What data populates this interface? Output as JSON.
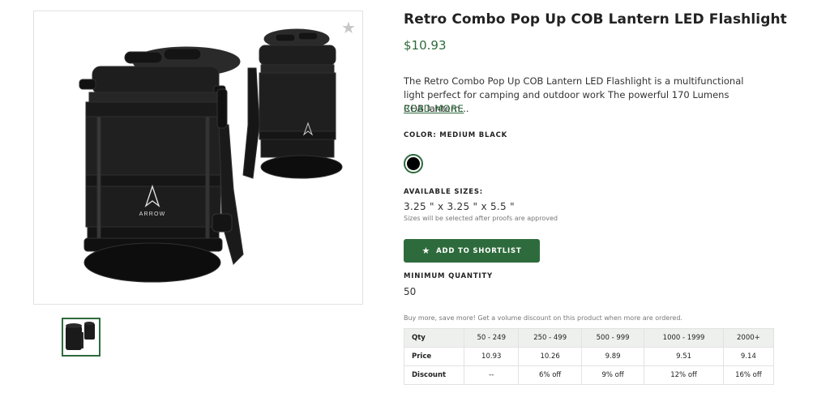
{
  "product": {
    "title": "Retro Combo Pop Up COB Lantern LED Flashlight",
    "price": "$10.93",
    "description": "The Retro Combo Pop Up COB Lantern LED Flashlight is a multifunctional light perfect for camping and outdoor work The powerful 170 Lumens COB lantern...",
    "read_more": "READ MORE",
    "brand_mark": "ARROW"
  },
  "color": {
    "label": "COLOR: MEDIUM BLACK",
    "swatch_hex": "#000000"
  },
  "sizes": {
    "label": "AVAILABLE SIZES:",
    "value": "3.25 \" x 3.25 \" x 5.5 \"",
    "note": "Sizes will be selected after proofs are approved"
  },
  "actions": {
    "shortlist_label": "ADD TO SHORTLIST"
  },
  "minimum": {
    "label": "MINIMUM QUANTITY",
    "value": "50"
  },
  "volume": {
    "note": "Buy more, save more! Get a volume discount on this product when more are ordered.",
    "headers": [
      "Qty",
      "50 - 249",
      "250 - 499",
      "500 - 999",
      "1000 - 1999",
      "2000+"
    ],
    "price_row": [
      "Price",
      "10.93",
      "10.26",
      "9.89",
      "9.51",
      "9.14"
    ],
    "discount_row": [
      "Discount",
      "--",
      "6% off",
      "9% off",
      "12% off",
      "16% off"
    ]
  },
  "colors": {
    "accent": "#2e6b3c",
    "border": "#e2e2e2",
    "table_header_bg": "#eef0ee"
  },
  "icons": {
    "favorite": "star-icon",
    "shortlist": "star-icon"
  }
}
